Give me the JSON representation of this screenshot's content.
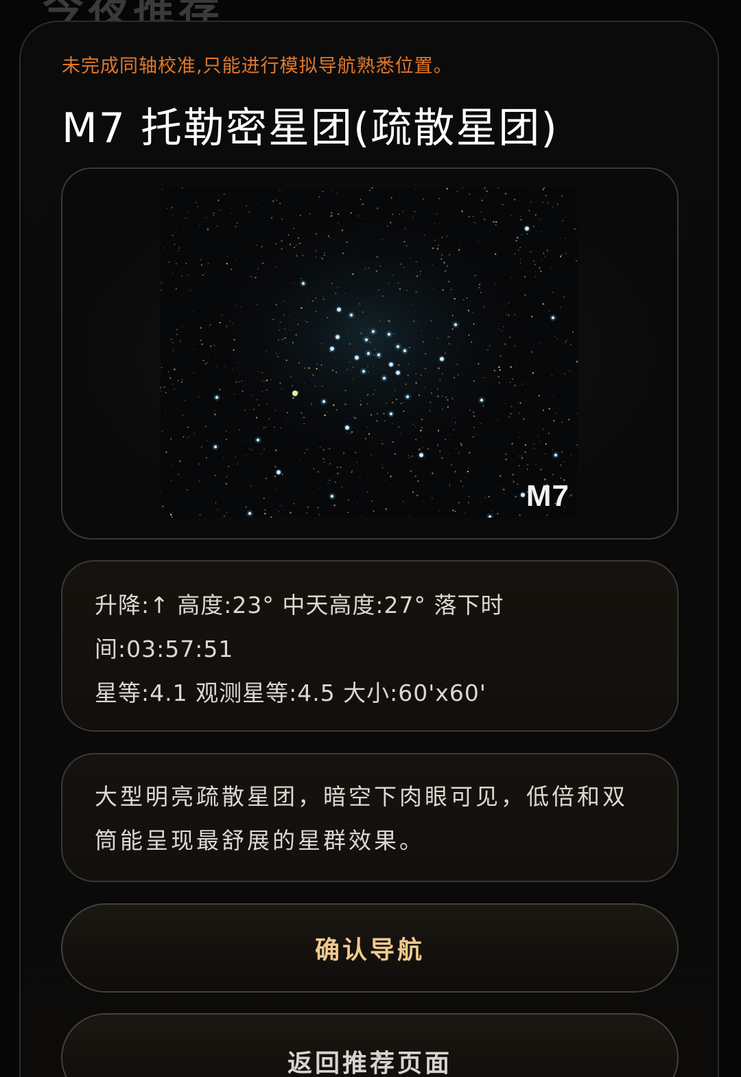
{
  "background": {
    "title": "今夜推荐"
  },
  "sheet": {
    "warning": "未完成同轴校准,只能进行模拟导航熟悉位置。",
    "title": "M7 托勒密星团(疏散星团)",
    "image": {
      "label": "M7"
    },
    "info": {
      "line1": "升降:↑ 高度:23° 中天高度:27° 落下时间:03:57:51",
      "line2": "星等:4.1 观测星等:4.5 大小:60'x60'"
    },
    "description": "大型明亮疏散星团，暗空下肉眼可见，低倍和双筒能呈现最舒展的星群效果。",
    "buttons": {
      "confirm": "确认导航",
      "back": "返回推荐页面"
    }
  },
  "colors": {
    "warning": "#e0782c",
    "confirm_text": "#f0c98f",
    "background": "#060606"
  }
}
